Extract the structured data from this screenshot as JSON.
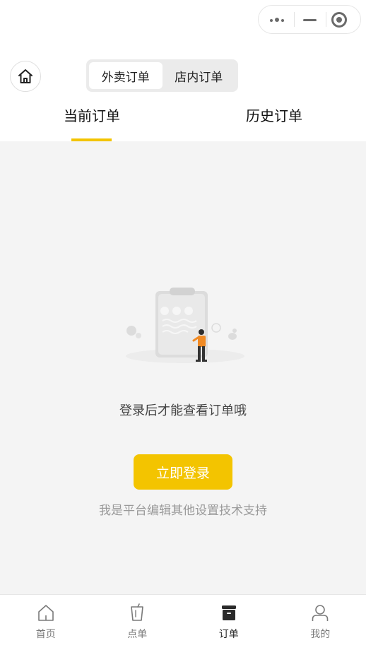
{
  "capsule": {
    "more_icon": "more-dots-icon",
    "minimize_icon": "minimize-icon",
    "close_icon": "target-close-icon"
  },
  "header": {
    "home_icon": "home-icon"
  },
  "segment": {
    "items": [
      {
        "label": "外卖订单",
        "active": true
      },
      {
        "label": "店内订单",
        "active": false
      }
    ]
  },
  "tabs": {
    "items": [
      {
        "label": "当前订单",
        "active": true
      },
      {
        "label": "历史订单",
        "active": false
      }
    ],
    "accent": "#f3c400"
  },
  "empty": {
    "message": "登录后才能查看订单哦",
    "login_label": "立即登录",
    "support": "我是平台编辑其他设置技术支持"
  },
  "tabbar": {
    "items": [
      {
        "label": "首页",
        "icon": "home-outline-icon",
        "active": false
      },
      {
        "label": "点单",
        "icon": "cup-icon",
        "active": false
      },
      {
        "label": "订单",
        "icon": "order-box-icon",
        "active": true
      },
      {
        "label": "我的",
        "icon": "user-icon",
        "active": false
      }
    ]
  },
  "colors": {
    "accent": "#f3c400",
    "background": "#f4f4f4"
  }
}
